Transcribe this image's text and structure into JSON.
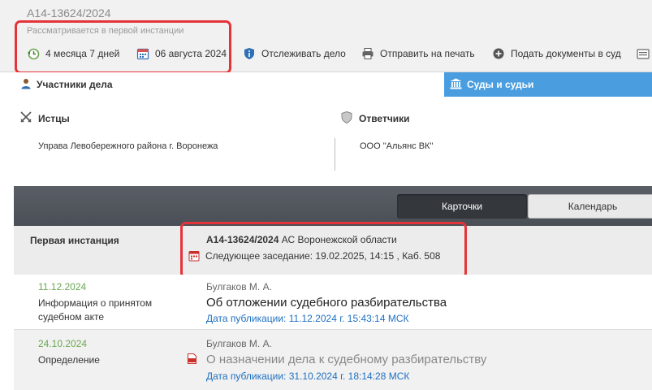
{
  "case": {
    "number": "А14-13624/2024",
    "status": "Рассматривается в первой инстанции"
  },
  "toolbar": {
    "duration": "4 месяца 7 дней",
    "date": "06 августа 2024",
    "track": "Отслеживать дело",
    "print": "Отправить на печать",
    "submit": "Подать документы в суд"
  },
  "tabs": {
    "participants": "Участники дела",
    "courts": "Суды и судьи"
  },
  "parties": {
    "plaintiffs_label": "Истцы",
    "plaintiff": "Управа Левобережного района г. Воронежа",
    "defendants_label": "Ответчики",
    "defendant": "ООО \"Альянс ВК\""
  },
  "view": {
    "cards": "Карточки",
    "calendar": "Календарь"
  },
  "instance": {
    "label": "Первая инстанция",
    "case_number": "А14-13624/2024",
    "court": " АС Воронежской области",
    "next_hearing": "Следующее заседание: 19.02.2025, 14:15 , Каб. 508"
  },
  "documents": [
    {
      "date": "11.12.2024",
      "type": "Информация о принятом судебном акте",
      "judge": "Булгаков М. А.",
      "title": "Об отложении судебного разбирательства",
      "published": "Дата публикации: 11.12.2024 г. 15:43:14 МСК"
    },
    {
      "date": "24.10.2024",
      "type": "Определение",
      "judge": "Булгаков М. А.",
      "title": "О назначении дела к судебному разбирательству",
      "published": "Дата публикации: 31.10.2024 г. 18:14:28 МСК"
    }
  ],
  "colors": {
    "accent_blue": "#4a9ee0",
    "highlight_red": "#e4343a",
    "date_green": "#6aa84f",
    "link_blue": "#1e6fc0"
  }
}
